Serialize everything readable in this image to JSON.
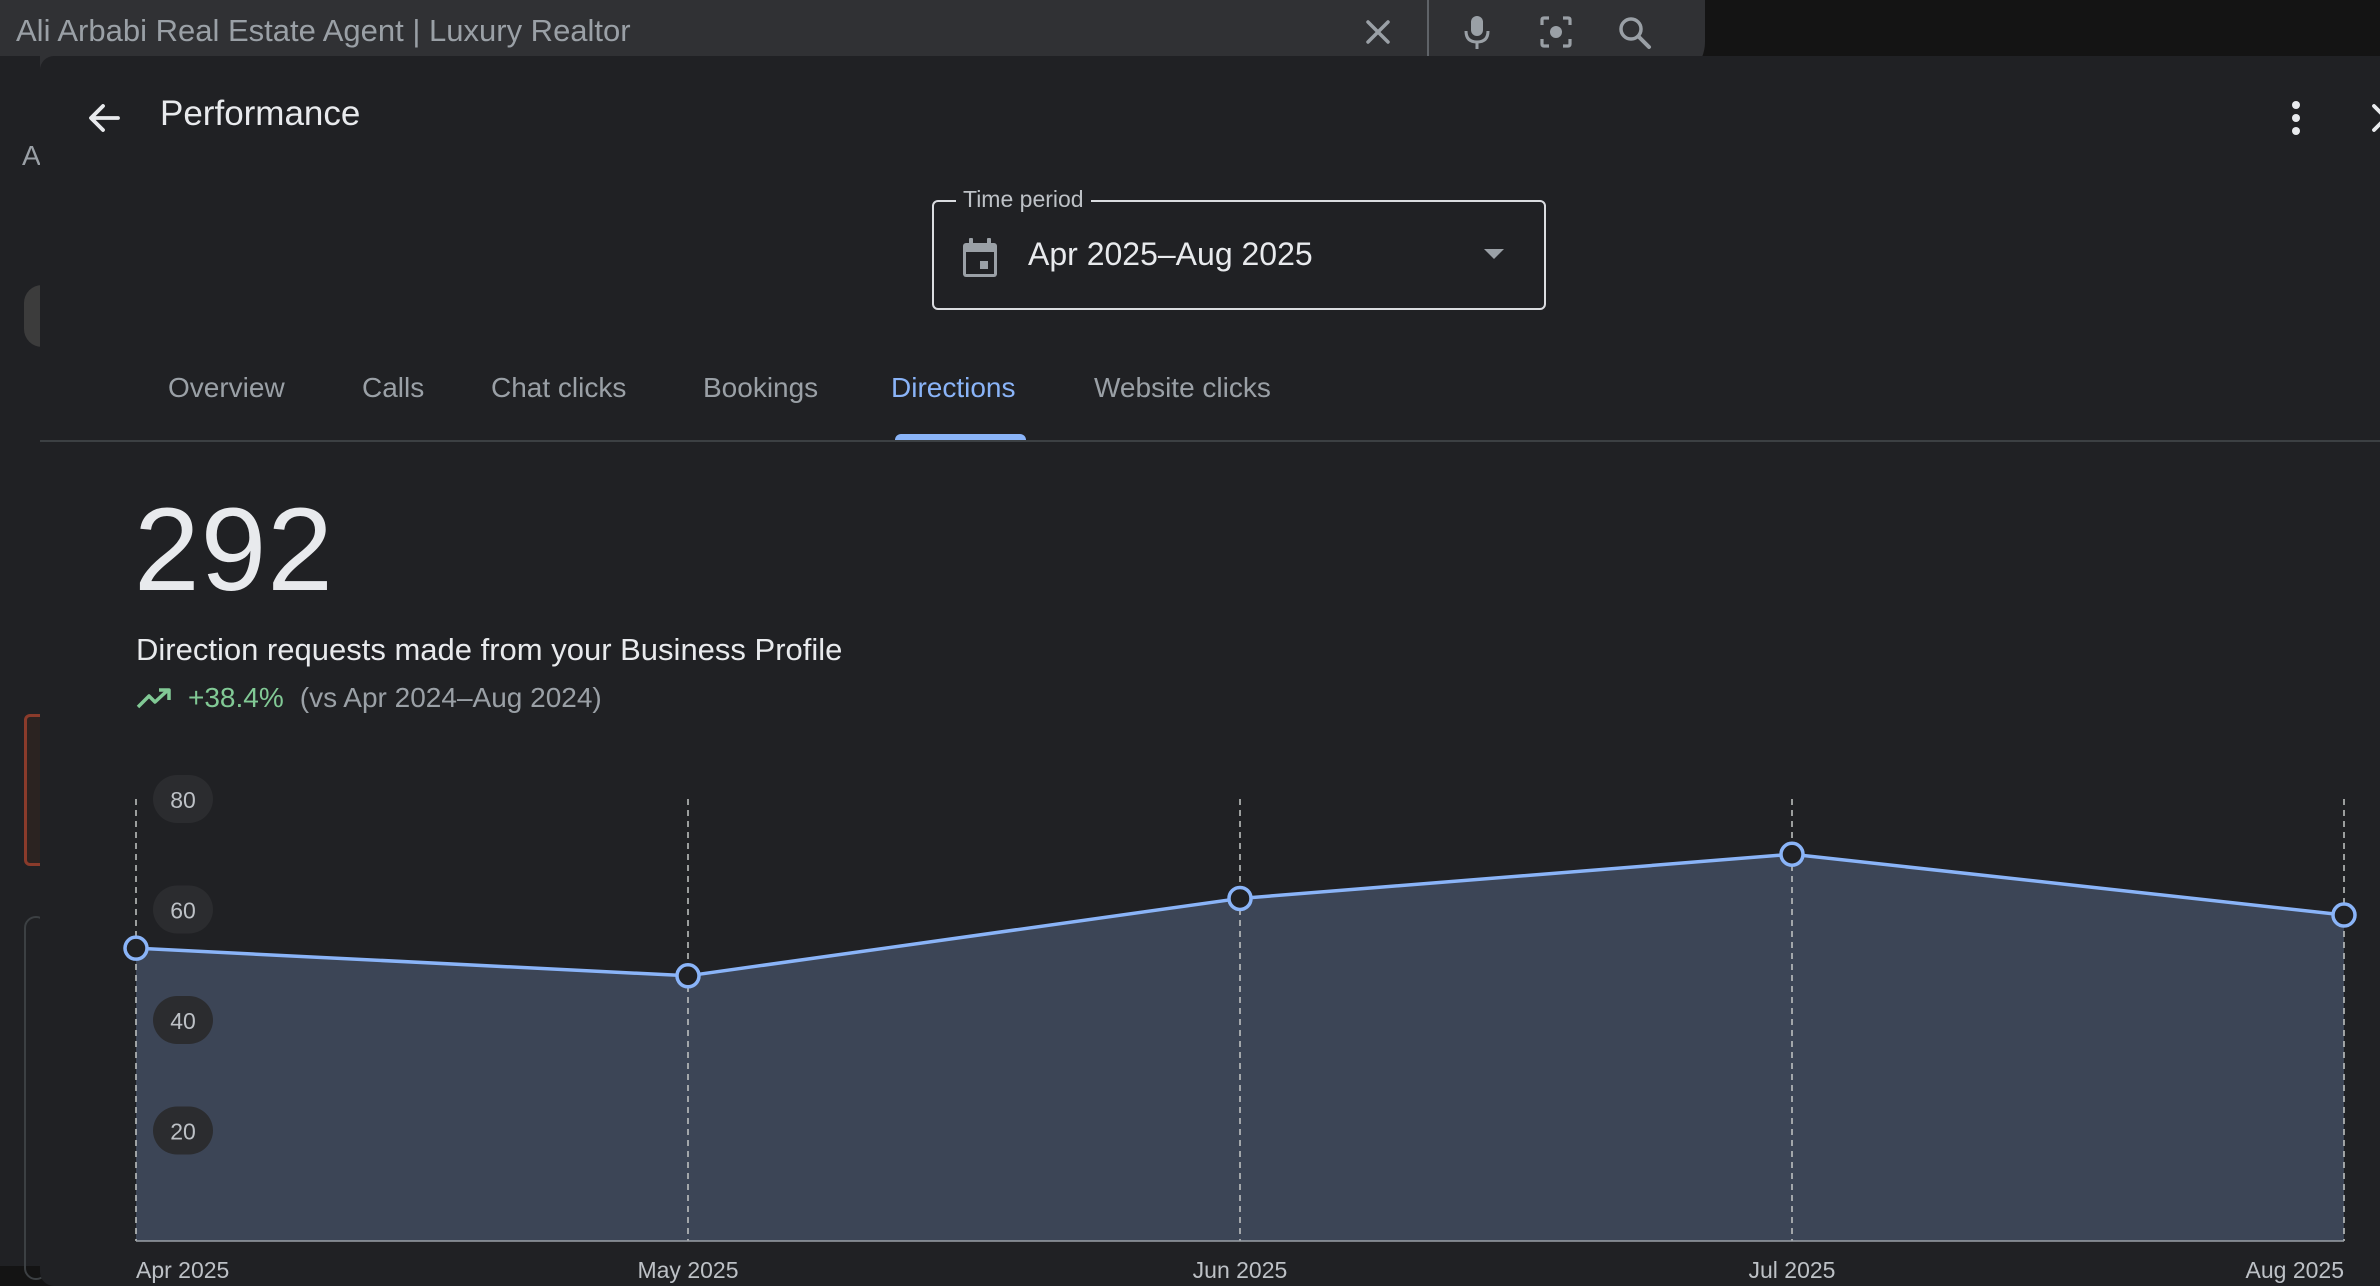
{
  "search": {
    "query": "Ali Arbabi Real Estate Agent | Luxury Realtor",
    "icons": [
      "close-icon",
      "mic-icon",
      "lens-icon",
      "search-icon"
    ]
  },
  "background": {
    "fragment_text": "A"
  },
  "dialog": {
    "title": "Performance",
    "icons": [
      "back-arrow-icon",
      "more-vert-icon",
      "close-icon"
    ]
  },
  "time_period": {
    "label": "Time period",
    "value": "Apr 2025–Aug 2025"
  },
  "tabs": [
    {
      "label": "Overview",
      "active": false
    },
    {
      "label": "Calls",
      "active": false
    },
    {
      "label": "Chat clicks",
      "active": false
    },
    {
      "label": "Bookings",
      "active": false
    },
    {
      "label": "Directions",
      "active": true
    },
    {
      "label": "Website clicks",
      "active": false
    }
  ],
  "metric": {
    "value": "292",
    "description": "Direction requests made from your Business Profile",
    "trend": "+38.4%",
    "comparison": "(vs Apr 2024–Aug 2024)"
  },
  "colors": {
    "accent": "#8ab4f8",
    "positive": "#81c995",
    "surface": "#202124",
    "area_fill": "#3c4556"
  },
  "chart_data": {
    "type": "area",
    "categories": [
      "Apr 2025",
      "May 2025",
      "Jun 2025",
      "Jul 2025",
      "Aug 2025"
    ],
    "values": [
      53,
      48,
      62,
      70,
      59
    ],
    "yticks": [
      20,
      40,
      60,
      80
    ],
    "ylim": [
      0,
      80
    ],
    "grid": "vertical dashed",
    "legend": "none"
  }
}
